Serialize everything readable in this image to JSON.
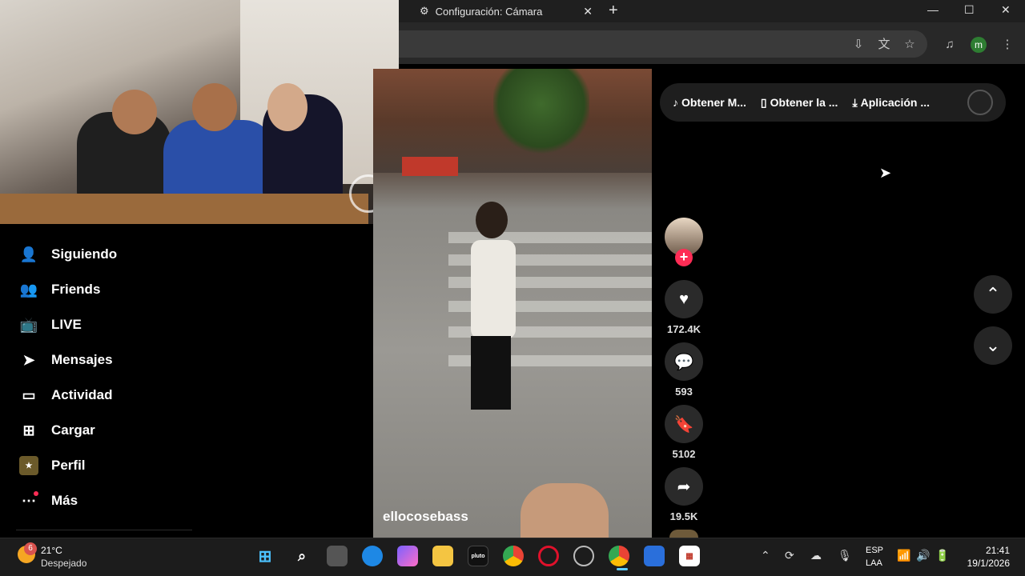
{
  "browser": {
    "tab_title": "Configuración: Cámara",
    "new_tab": "+",
    "profile_initial": "m"
  },
  "sidebar": {
    "items": [
      {
        "label": "Siguiendo",
        "icon": "following-icon"
      },
      {
        "label": "Friends",
        "icon": "friends-icon"
      },
      {
        "label": "LIVE",
        "icon": "live-icon"
      },
      {
        "label": "Mensajes",
        "icon": "messages-icon"
      },
      {
        "label": "Actividad",
        "icon": "activity-icon"
      },
      {
        "label": "Cargar",
        "icon": "upload-icon"
      },
      {
        "label": "Perfil",
        "icon": "profile-icon"
      },
      {
        "label": "Más",
        "icon": "more-icon"
      }
    ]
  },
  "video": {
    "username": "ellocosebass"
  },
  "actions": {
    "likes": "172.4K",
    "comments": "593",
    "saves": "5102",
    "shares": "19.5K"
  },
  "banner": {
    "item1": "Obtener M...",
    "item2": "Obtener la ...",
    "item3": "Aplicación ..."
  },
  "taskbar": {
    "weather_badge": "6",
    "temperature": "21°C",
    "weather_desc": "Despejado",
    "lang_line1": "ESP",
    "lang_line2": "LAA",
    "time": "21:41",
    "date": "19/1/2026"
  },
  "colors": {
    "accent_pink": "#fe2c55",
    "background": "#000000",
    "chrome_dark": "#1f1f1f"
  }
}
